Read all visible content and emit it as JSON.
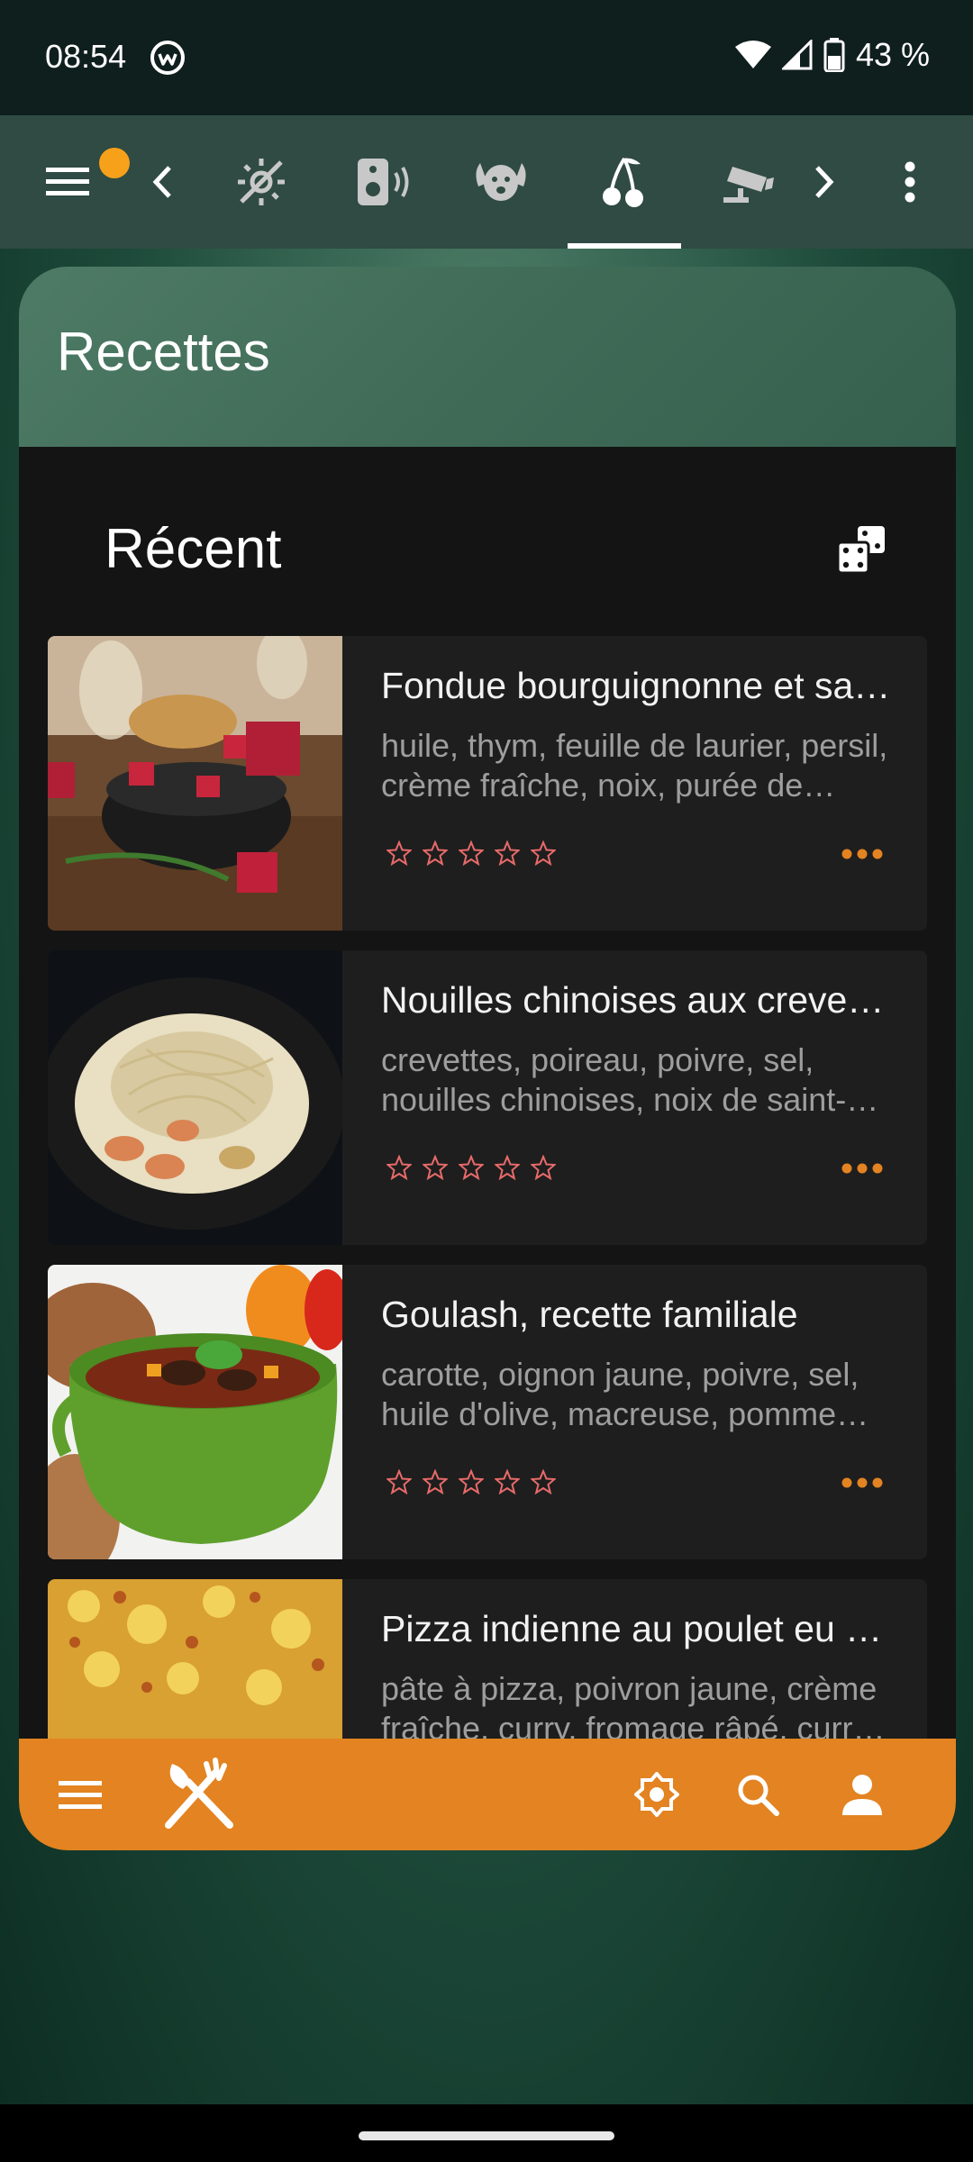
{
  "status_bar": {
    "time": "08:54",
    "battery": "43 %"
  },
  "toolbar": {
    "icons": [
      "menu-icon",
      "chevron-left-icon",
      "weather-icon",
      "speaker-icon",
      "pet-icon",
      "cherry-icon",
      "camera-icon",
      "chevron-right-icon",
      "more-vert-icon"
    ],
    "selected_tab": "cherry-icon",
    "notification_color": "#f7a11a"
  },
  "widget": {
    "title": "Recettes",
    "section_title": "Récent",
    "recipes": [
      {
        "title": "Fondue bourguignonne et sa…",
        "description": "huile, thym, feuille de laurier, persil, crème fraîche, noix, purée de…"
      },
      {
        "title": "Nouilles chinoises aux creve…",
        "description": "crevettes, poireau, poivre, sel, nouilles chinoises, noix de saint-…"
      },
      {
        "title": "Goulash, recette familiale",
        "description": "carotte, oignon jaune, poivre, sel, huile d'olive, macreuse, pomme d…"
      },
      {
        "title": "Pizza indienne au poulet eu …",
        "description": "pâte à pizza, poivron jaune, crème fraîche, curry, fromage râpé, curr…"
      }
    ],
    "rating": 0,
    "star_color": "#e86a6a",
    "more_color": "#e38321"
  },
  "bottom_bar": {
    "color": "#e38321",
    "icons": [
      "menu-icon",
      "utensils-icon",
      "brightness-icon",
      "search-icon",
      "account-icon"
    ]
  }
}
